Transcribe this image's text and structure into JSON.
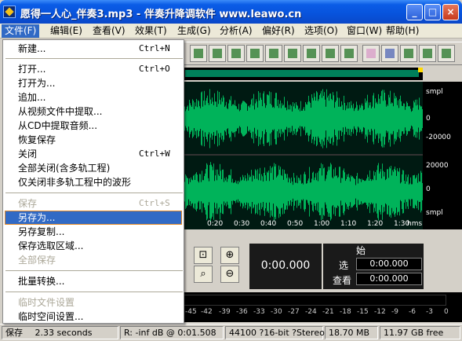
{
  "window": {
    "title": "愿得一人心_伴奏3.mp3 - 伴奏升降调软件 www.leawo.cn",
    "minimize": "_",
    "maximize": "□",
    "close": "×"
  },
  "menubar": [
    {
      "label": "文件(F)",
      "active": true
    },
    {
      "label": "编辑(E)"
    },
    {
      "label": "查看(V)"
    },
    {
      "label": "效果(T)"
    },
    {
      "label": "生成(G)"
    },
    {
      "label": "分析(A)"
    },
    {
      "label": "偏好(R)"
    },
    {
      "label": "选项(O)"
    },
    {
      "label": "窗口(W)"
    },
    {
      "label": "帮助(H)"
    }
  ],
  "file_menu": {
    "new": {
      "label": "新建...",
      "shortcut": "Ctrl+N"
    },
    "open": {
      "label": "打开...",
      "shortcut": "Ctrl+O"
    },
    "open_as": {
      "label": "打开为..."
    },
    "append": {
      "label": "追加..."
    },
    "extract_video": {
      "label": "从视频文件中提取..."
    },
    "extract_cd": {
      "label": "从CD中提取音频..."
    },
    "restore_save": {
      "label": "恢复保存"
    },
    "close": {
      "label": "关闭",
      "shortcut": "Ctrl+W"
    },
    "close_all": {
      "label": "全部关闭(含多轨工程)"
    },
    "close_non_multitrack": {
      "label": "仅关闭非多轨工程中的波形"
    },
    "save": {
      "label": "保存",
      "shortcut": "Ctrl+S"
    },
    "save_as": {
      "label": "另存为..."
    },
    "save_copy": {
      "label": "另存复制..."
    },
    "save_selection": {
      "label": "保存选取区域..."
    },
    "save_all": {
      "label": "全部保存"
    },
    "batch_convert": {
      "label": "批量转换..."
    },
    "temp_settings": {
      "label": "临时文件设置"
    },
    "temp_space": {
      "label": "临时空间设置..."
    }
  },
  "waveform": {
    "ruler_unit": "smpl",
    "ruler_ticks": [
      "smpl",
      "0",
      "-20000",
      "20000",
      "0",
      "smpl"
    ],
    "time_unit": "hms",
    "time_ticks": [
      "0:20",
      "0:30",
      "0:40",
      "0:50",
      "1:00",
      "1:10",
      "1:20",
      "1:30"
    ]
  },
  "time_display": "0:00.000",
  "selection": {
    "header": "始",
    "select_label": "选",
    "select_value": "0:00.000",
    "view_label": "查看",
    "view_value": "0:00.000"
  },
  "meter": {
    "scale": [
      "-39",
      "-36",
      "-33",
      "-30",
      "-27",
      "-24",
      "-21",
      "-18",
      "-15",
      "-12",
      "-9",
      "-6",
      "-3",
      "0"
    ],
    "partial_scale": [
      "-45",
      "-42"
    ]
  },
  "statusbar": {
    "state": "保存",
    "duration": "2.33 seconds",
    "cursor": "R: -inf dB @  0:01.508",
    "format": "44100 ?16-bit ?Stereo",
    "size": "18.70 MB",
    "free": "11.97 GB free"
  },
  "colors": {
    "titlebar": "#0853dc",
    "menu_highlight": "#316ac5",
    "waveform": "#00b35a",
    "waveform_bg": "#001a12"
  }
}
